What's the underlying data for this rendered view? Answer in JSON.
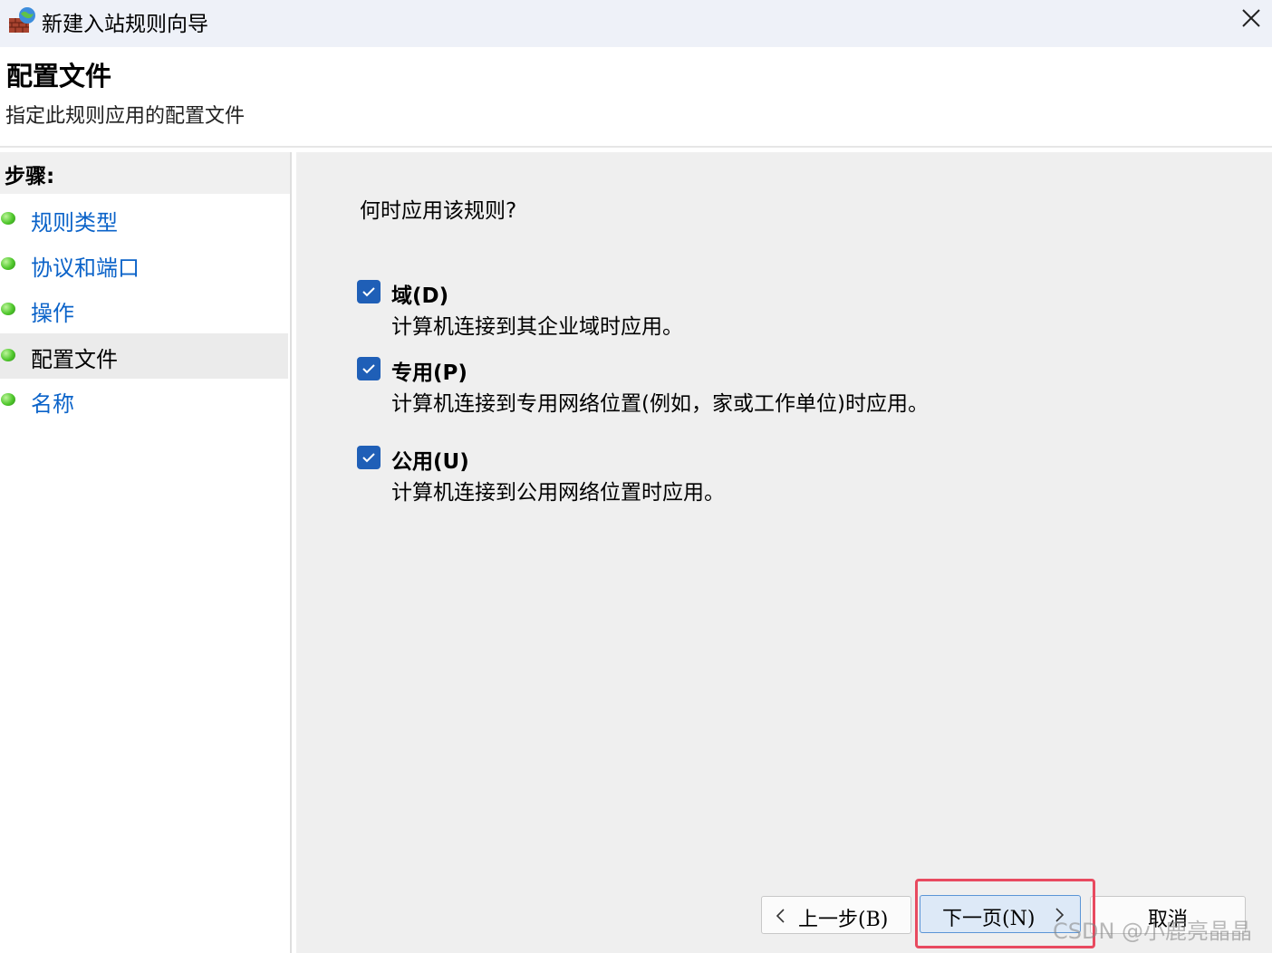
{
  "window": {
    "title": "新建入站规则向导",
    "icon": "firewall-icon",
    "close_icon": "close-icon"
  },
  "header": {
    "title": "配置文件",
    "subtitle": "指定此规则应用的配置文件"
  },
  "sidebar": {
    "steps_label": "步骤:",
    "steps": [
      {
        "label": "规则类型",
        "current": false
      },
      {
        "label": "协议和端口",
        "current": false
      },
      {
        "label": "操作",
        "current": false
      },
      {
        "label": "配置文件",
        "current": true
      },
      {
        "label": "名称",
        "current": false
      }
    ]
  },
  "main": {
    "question": "何时应用该规则?",
    "options": [
      {
        "title": "域(D)",
        "description": "计算机连接到其企业域时应用。",
        "checked": true
      },
      {
        "title": "专用(P)",
        "description": "计算机连接到专用网络位置(例如，家或工作单位)时应用。",
        "checked": true
      },
      {
        "title": "公用(U)",
        "description": "计算机连接到公用网络位置时应用。",
        "checked": true
      }
    ]
  },
  "buttons": {
    "back": "上一步(B)",
    "next": "下一页(N)",
    "cancel": "取消"
  },
  "watermark": "CSDN @小鹿亮晶晶",
  "colors": {
    "accent": "#1f5fb7",
    "link": "#0b63c9",
    "highlight": "#e84a5f",
    "step_dot": "#4fc72c"
  }
}
